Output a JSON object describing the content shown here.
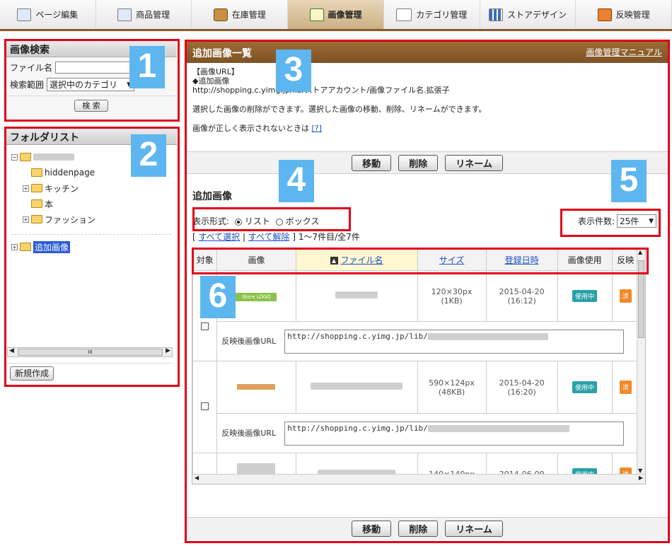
{
  "tabs": [
    {
      "label": "ページ編集",
      "icon": "page-edit-icon",
      "active": false
    },
    {
      "label": "商品管理",
      "icon": "product-icon",
      "active": false
    },
    {
      "label": "在庫管理",
      "icon": "inventory-box-icon",
      "active": false
    },
    {
      "label": "画像管理",
      "icon": "image-icon",
      "active": true
    },
    {
      "label": "カテゴリ管理",
      "icon": "category-tree-icon",
      "active": false
    },
    {
      "label": "ストアデザイン",
      "icon": "store-design-icon",
      "active": false
    },
    {
      "label": "反映管理",
      "icon": "publish-icon",
      "active": false
    }
  ],
  "search": {
    "title": "画像検索",
    "file_label": "ファイル名",
    "file_value": "",
    "scope_label": "検索範囲",
    "scope_value": "選択中のカテゴリ",
    "button": "検 索"
  },
  "folders": {
    "title": "フォルダリスト",
    "items": [
      "hiddenpage",
      "キッチン",
      "本",
      "ファッション"
    ],
    "extra": "追加画像",
    "new_button": "新規作成",
    "scroll_grip": "III"
  },
  "main": {
    "title": "追加画像一覧",
    "manual_link": "画像管理マニュアル",
    "url_heading": "【画像URL】",
    "url_sub": "◆追加画像",
    "url_pattern": "http://shopping.c.yimg.jp/lib/ストアアカウント/画像ファイル名.拡張子",
    "desc": "選択した画像の削除ができます。選択した画像の移動、削除、リネームができます。",
    "help_text": "画像が正しく表示されないときは",
    "help_link": "[?]",
    "buttons": {
      "move": "移動",
      "delete": "削除",
      "rename": "リネーム"
    },
    "section_title": "追加画像",
    "display_label": "表示形式:",
    "display_list": "リスト",
    "display_box": "ボックス",
    "count_label": "表示件数:",
    "count_value": "25件",
    "select_all": "すべて選択",
    "deselect_all": "すべて解除",
    "range_text": "1〜7件目/全7件"
  },
  "table": {
    "headers": {
      "target": "対象",
      "image": "画像",
      "filename": "ファイル名",
      "size": "サイズ",
      "date": "登録日時",
      "usage": "画像使用",
      "publish": "反映"
    },
    "url_label": "反映後画像URL",
    "url_prefix": "http://shopping.c.yimg.jp/lib/",
    "rows": [
      {
        "thumb_text": "Store LOGO",
        "dims": "120×30px",
        "kb": "(1KB)",
        "date": "2015-04-20",
        "time": "(16:12)",
        "usage": "使用中",
        "publish": "済"
      },
      {
        "thumb_text": "",
        "dims": "590×124px",
        "kb": "(48KB)",
        "date": "2015-04-20",
        "time": "(16:20)",
        "usage": "使用中",
        "publish": "済"
      },
      {
        "thumb_text": "",
        "dims": "140×140px",
        "kb": "",
        "date": "2014-06-09",
        "time": "",
        "usage": "使用中",
        "publish": "済"
      }
    ]
  },
  "markers": [
    "1",
    "2",
    "3",
    "4",
    "5",
    "6"
  ],
  "colors": {
    "highlight": "#e0001a",
    "marker": "#5db6ef",
    "header": "#8a5a2b",
    "badge_teal": "#2aa1a9",
    "badge_orange": "#f08a2a"
  }
}
